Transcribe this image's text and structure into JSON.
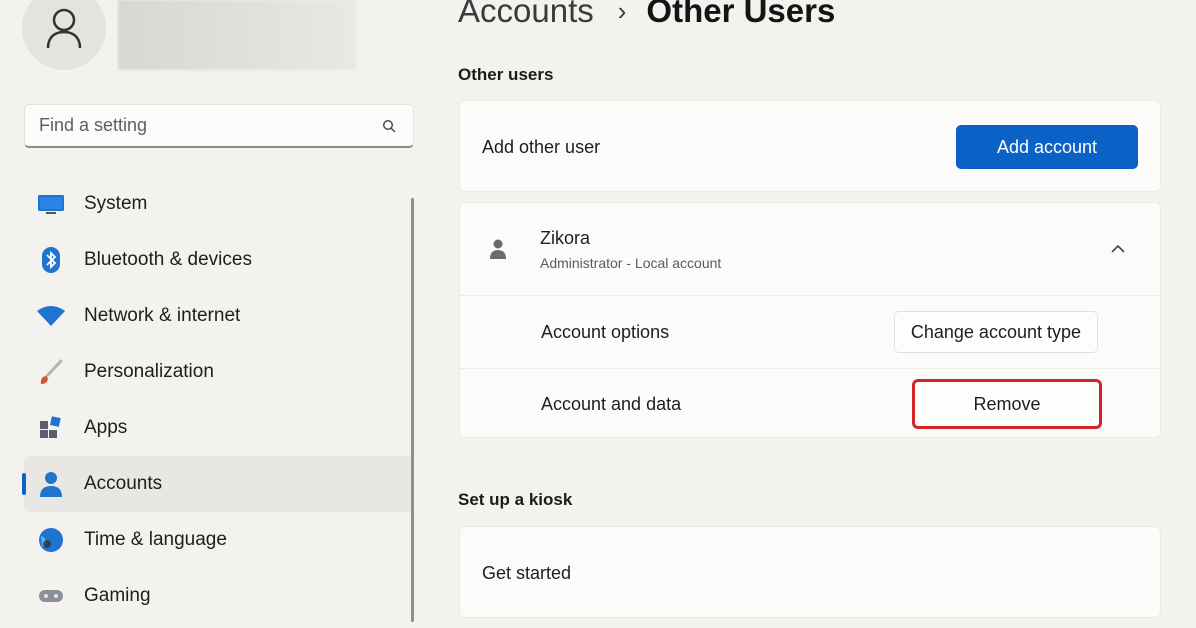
{
  "sidebar": {
    "avatar_icon": "person-icon",
    "search": {
      "placeholder": "Find a setting",
      "value": "",
      "icon": "search-icon"
    },
    "items": [
      {
        "label": "System",
        "icon": "monitor-icon",
        "active": false
      },
      {
        "label": "Bluetooth & devices",
        "icon": "bluetooth-icon",
        "active": false
      },
      {
        "label": "Network & internet",
        "icon": "wifi-icon",
        "active": false
      },
      {
        "label": "Personalization",
        "icon": "brush-icon",
        "active": false
      },
      {
        "label": "Apps",
        "icon": "apps-icon",
        "active": false
      },
      {
        "label": "Accounts",
        "icon": "accounts-icon",
        "active": true
      },
      {
        "label": "Time & language",
        "icon": "globe-icon",
        "active": false
      },
      {
        "label": "Gaming",
        "icon": "gamepad-icon",
        "active": false
      }
    ]
  },
  "header": {
    "parent": "Accounts",
    "separator": "›",
    "current": "Other Users"
  },
  "other_users": {
    "title": "Other users",
    "add_label": "Add other user",
    "add_button": "Add account",
    "user": {
      "name": "Zikora",
      "subtitle": "Administrator - Local account",
      "icon": "person-icon",
      "expanded": true
    },
    "account_options_label": "Account options",
    "change_type_button": "Change account type",
    "account_data_label": "Account and data",
    "remove_button": "Remove"
  },
  "kiosk": {
    "title": "Set up a kiosk",
    "get_started": "Get started"
  },
  "colors": {
    "accent": "#0a62c7",
    "highlight": "#d3222a",
    "background": "#f3f2ee"
  }
}
